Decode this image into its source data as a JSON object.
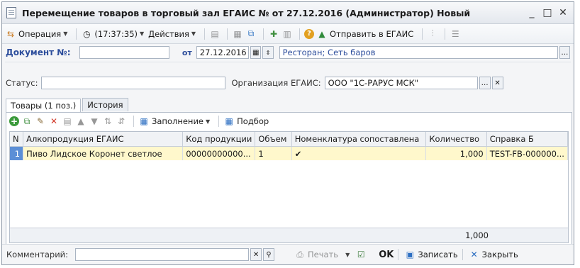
{
  "window": {
    "title": "Перемещение товаров в торговый зал ЕГАИС № от 27.12.2016 (Администратор) Новый",
    "minimize_glyph": "_",
    "maximize_glyph": "□",
    "close_glyph": "✕"
  },
  "toolbar": {
    "operation_label": "Операция",
    "time_label": "(17:37:35)",
    "actions_label": "Действия",
    "send_egais_label": "Отправить в ЕГАИС"
  },
  "header": {
    "doc_number_label": "Документ №:",
    "doc_number_value": "",
    "from_label": "от",
    "date_value": "27.12.2016",
    "store_value": "Ресторан; Сеть баров",
    "status_label": "Статус:",
    "status_value": "",
    "org_label": "Организация ЕГАИС:",
    "org_value": "ООО \"1С-РАРУС МСК\""
  },
  "tabs": [
    {
      "label": "Товары (1 поз.)",
      "active": true
    },
    {
      "label": "История",
      "active": false
    }
  ],
  "inner_toolbar": {
    "fill_label": "Заполнение",
    "select_label": "Подбор"
  },
  "grid": {
    "columns": [
      "N",
      "Алкопродукция ЕГАИС",
      "Код продукции",
      "Объем",
      "Номенклатура сопоставлена",
      "Количество",
      "Справка Б"
    ],
    "rows": [
      [
        "1",
        "Пиво Лидское Коронет светлое",
        "00000000000...",
        "1",
        "✔",
        "1,000",
        "TEST-FB-000000..."
      ]
    ],
    "total_quantity": "1,000"
  },
  "footer": {
    "comment_label": "Комментарий:",
    "comment_value": "",
    "print_label": "Печать",
    "ok_label": "OK",
    "save_label": "Записать",
    "close_label": "Закрыть"
  },
  "colors": {
    "accent_blue": "#2d4e9c",
    "selected_row": "#fff8cc",
    "selected_num": "#5c8fd6"
  }
}
